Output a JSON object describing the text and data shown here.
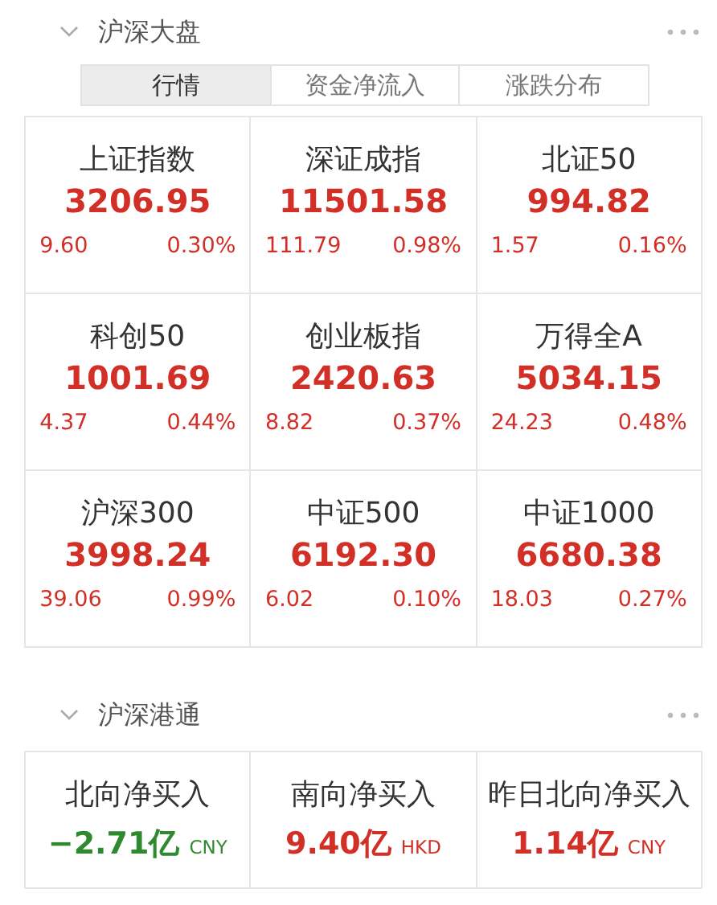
{
  "sections": [
    {
      "title": "沪深大盘",
      "expanded": true,
      "tabs": [
        {
          "label": "行情",
          "selected": true
        },
        {
          "label": "资金净流入",
          "selected": false
        },
        {
          "label": "涨跌分布",
          "selected": false
        }
      ],
      "indices": [
        {
          "name": "上证指数",
          "value": "3206.95",
          "change": "9.60",
          "percent": "0.30%",
          "color": "#d22f27"
        },
        {
          "name": "深证成指",
          "value": "11501.58",
          "change": "111.79",
          "percent": "0.98%",
          "color": "#d22f27"
        },
        {
          "name": "北证50",
          "value": "994.82",
          "change": "1.57",
          "percent": "0.16%",
          "color": "#d22f27"
        },
        {
          "name": "科创50",
          "value": "1001.69",
          "change": "4.37",
          "percent": "0.44%",
          "color": "#d22f27"
        },
        {
          "name": "创业板指",
          "value": "2420.63",
          "change": "8.82",
          "percent": "0.37%",
          "color": "#d22f27"
        },
        {
          "name": "万得全A",
          "value": "5034.15",
          "change": "24.23",
          "percent": "0.48%",
          "color": "#d22f27"
        },
        {
          "name": "沪深300",
          "value": "3998.24",
          "change": "39.06",
          "percent": "0.99%",
          "color": "#d22f27"
        },
        {
          "name": "中证500",
          "value": "6192.30",
          "change": "6.02",
          "percent": "0.10%",
          "color": "#d22f27"
        },
        {
          "name": "中证1000",
          "value": "6680.38",
          "change": "18.03",
          "percent": "0.27%",
          "color": "#d22f27"
        }
      ]
    },
    {
      "title": "沪深港通",
      "expanded": true,
      "flows": [
        {
          "name": "北向净买入",
          "amount": "−2.71亿",
          "currency": "CNY",
          "color": "#2f8a2f"
        },
        {
          "name": "南向净买入",
          "amount": "9.40亿",
          "currency": "HKD",
          "color": "#d22f27"
        },
        {
          "name": "昨日北向净买入",
          "amount": "1.14亿",
          "currency": "CNY",
          "color": "#d22f27"
        }
      ]
    }
  ]
}
